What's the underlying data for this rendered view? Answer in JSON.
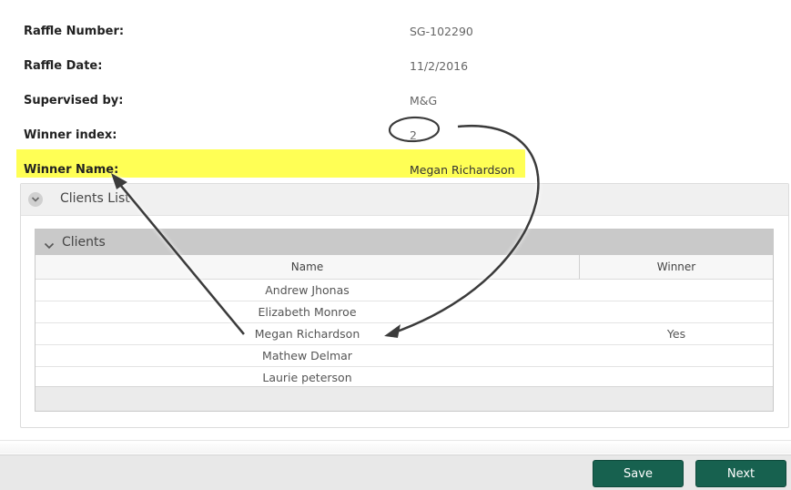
{
  "fields": [
    {
      "label": "Raffle Number:",
      "value": "SG-102290"
    },
    {
      "label": "Raffle Date:",
      "value": "11/2/2016"
    },
    {
      "label": "Supervised by:",
      "value": "M&G"
    },
    {
      "label": "Winner index:",
      "value": "2"
    },
    {
      "label": "Winner Name:",
      "value": "Megan Richardson"
    }
  ],
  "panel": {
    "title": "Clients List",
    "grid": {
      "title": "Clients",
      "columns": [
        "Name",
        "Winner"
      ],
      "rows": [
        {
          "name": "Andrew Jhonas",
          "winner": ""
        },
        {
          "name": "Elizabeth Monroe",
          "winner": ""
        },
        {
          "name": "Megan Richardson",
          "winner": "Yes"
        },
        {
          "name": "Mathew Delmar",
          "winner": ""
        },
        {
          "name": "Laurie peterson",
          "winner": ""
        }
      ]
    }
  },
  "buttons": {
    "save": "Save",
    "next": "Next"
  },
  "colors": {
    "highlight": "#ffff55",
    "button": "#17614f"
  },
  "icons": {
    "collapse": "chevron-down-icon"
  }
}
